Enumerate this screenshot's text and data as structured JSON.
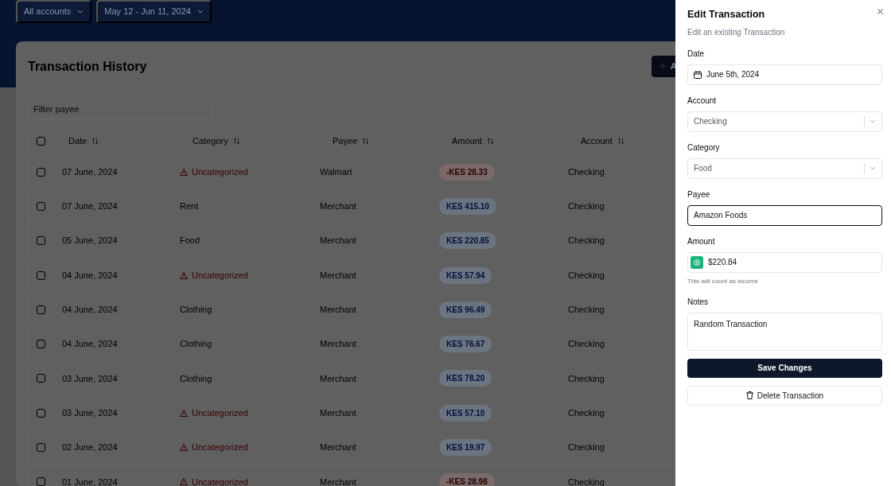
{
  "filters": [
    {
      "label": "All accounts"
    },
    {
      "label": "May 12 - Jun 11, 2024"
    }
  ],
  "card": {
    "title": "Transaction History",
    "add_button": "A",
    "filter": {
      "placeholder": "Filter payee"
    }
  },
  "table": {
    "select_all": {
      "checked": false
    },
    "columns": [
      "Date",
      "Category",
      "Payee",
      "Amount",
      "Account"
    ],
    "rows": [
      {
        "checked": false,
        "date": "07 June, 2024",
        "category": "Uncategorized",
        "uncategorized": true,
        "payee": "Walmart",
        "amount": "-KES 28.33",
        "kind": "expense",
        "account": "Checking"
      },
      {
        "checked": false,
        "date": "07 June, 2024",
        "category": "Rent",
        "uncategorized": false,
        "payee": "Merchant",
        "amount": "KES 415.10",
        "kind": "income",
        "account": "Checking"
      },
      {
        "checked": false,
        "date": "05 June, 2024",
        "category": "Food",
        "uncategorized": false,
        "payee": "Merchant",
        "amount": "KES 220.85",
        "kind": "income",
        "account": "Checking"
      },
      {
        "checked": false,
        "date": "04 June, 2024",
        "category": "Uncategorized",
        "uncategorized": true,
        "payee": "Merchant",
        "amount": "KES 57.94",
        "kind": "income",
        "account": "Checking"
      },
      {
        "checked": false,
        "date": "04 June, 2024",
        "category": "Clothing",
        "uncategorized": false,
        "payee": "Merchant",
        "amount": "KES 96.49",
        "kind": "income",
        "account": "Checking"
      },
      {
        "checked": false,
        "date": "04 June, 2024",
        "category": "Clothing",
        "uncategorized": false,
        "payee": "Merchant",
        "amount": "KES 76.67",
        "kind": "income",
        "account": "Checking"
      },
      {
        "checked": false,
        "date": "03 June, 2024",
        "category": "Clothing",
        "uncategorized": false,
        "payee": "Merchant",
        "amount": "KES 78.20",
        "kind": "income",
        "account": "Checking"
      },
      {
        "checked": false,
        "date": "03 June, 2024",
        "category": "Uncategorized",
        "uncategorized": true,
        "payee": "Merchant",
        "amount": "KES 57.10",
        "kind": "income",
        "account": "Checking"
      },
      {
        "checked": false,
        "date": "02 June, 2024",
        "category": "Uncategorized",
        "uncategorized": true,
        "payee": "Merchant",
        "amount": "KES 19.97",
        "kind": "income",
        "account": "Checking"
      },
      {
        "checked": false,
        "date": "01 June, 2024",
        "category": "Uncategorized",
        "uncategorized": true,
        "payee": "Merchant",
        "amount": "-KES 28.98",
        "kind": "expense",
        "account": "Checking"
      }
    ]
  },
  "drawer": {
    "title": "Edit Transaction",
    "subtitle": "Edit an existing Transaction",
    "fields": [
      {
        "kind": "date",
        "label": "Date",
        "value": "June 5th, 2024",
        "focused": false
      },
      {
        "kind": "select",
        "label": "Account",
        "value": "Checking",
        "focused": false
      },
      {
        "kind": "select",
        "label": "Category",
        "value": "Food",
        "focused": false
      },
      {
        "kind": "text",
        "label": "Payee",
        "value": "Amazon Foods",
        "focused": true
      },
      {
        "kind": "amount",
        "label": "Amount",
        "value": "$220.84",
        "hint": "This will count as income",
        "focused": false
      },
      {
        "kind": "textarea",
        "label": "Notes",
        "value": "Random Transaction",
        "focused": false
      }
    ],
    "save_button": "Save Changes",
    "delete_button": "Delete Transaction"
  }
}
